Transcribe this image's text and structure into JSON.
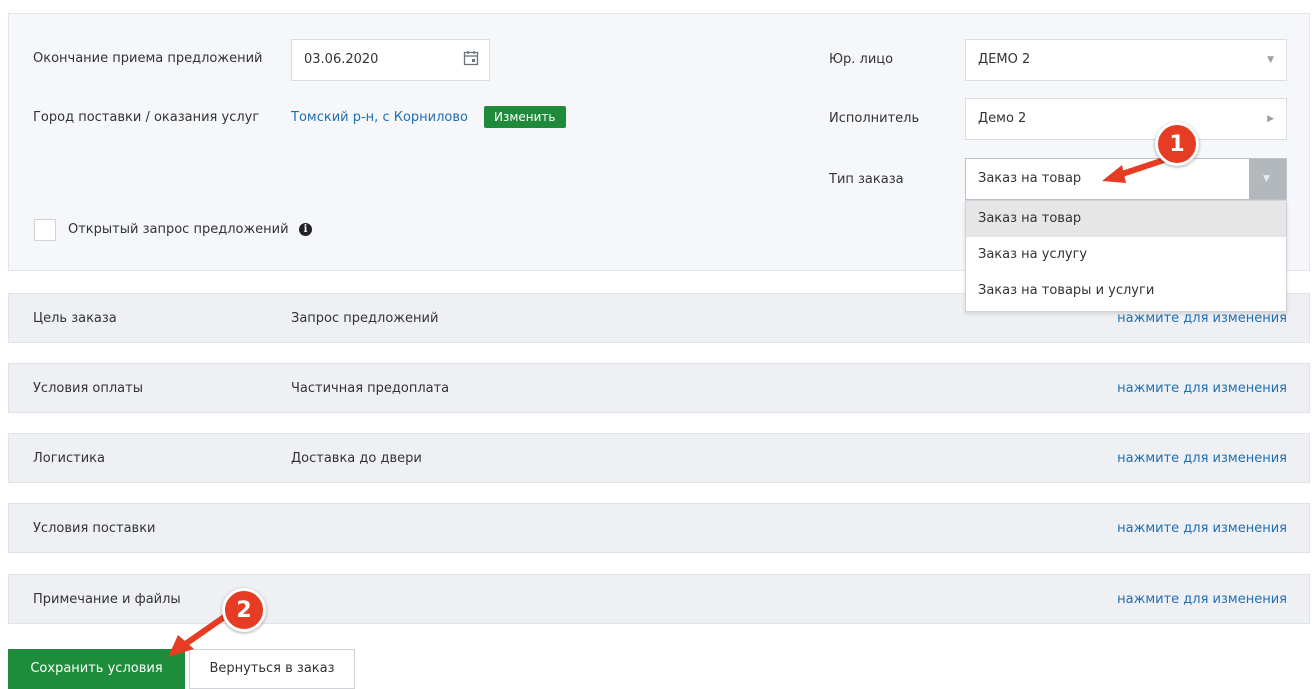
{
  "header_panel": {
    "deadline_label": "Окончание приема предложений",
    "deadline_value": "03.06.2020",
    "city_label": "Город поставки / оказания услуг",
    "city_value": "Томский р-н, с Корнилово",
    "change_button": "Изменить",
    "open_request_label": "Открытый запрос предложений",
    "legal_entity_label": "Юр. лицо",
    "legal_entity_value": "ДЕМО 2",
    "executor_label": "Исполнитель",
    "executor_value": "Демо 2",
    "order_type_label": "Тип заказа",
    "order_type_value": "Заказ на товар",
    "order_type_options": [
      "Заказ на товар",
      "Заказ на услугу",
      "Заказ на товары и услуги"
    ]
  },
  "sections": [
    {
      "title": "Цель заказа",
      "value": "Запрос предложений",
      "edit": "нажмите для изменения"
    },
    {
      "title": "Условия оплаты",
      "value": "Частичная предоплата",
      "edit": "нажмите для изменения"
    },
    {
      "title": "Логистика",
      "value": "Доставка до двери",
      "edit": "нажмите для изменения"
    },
    {
      "title": "Условия поставки",
      "value": "",
      "edit": "нажмите для изменения"
    },
    {
      "title": "Примечание и файлы",
      "value": "",
      "edit": "нажмите для изменения"
    }
  ],
  "actions": {
    "save": "Сохранить условия",
    "back": "Вернуться в заказ"
  },
  "annotations": {
    "badge_1": "1",
    "badge_2": "2"
  },
  "colors": {
    "accent_green": "#1e8d3b",
    "link_blue": "#1f6fb5",
    "badge_red": "#e53c23"
  }
}
